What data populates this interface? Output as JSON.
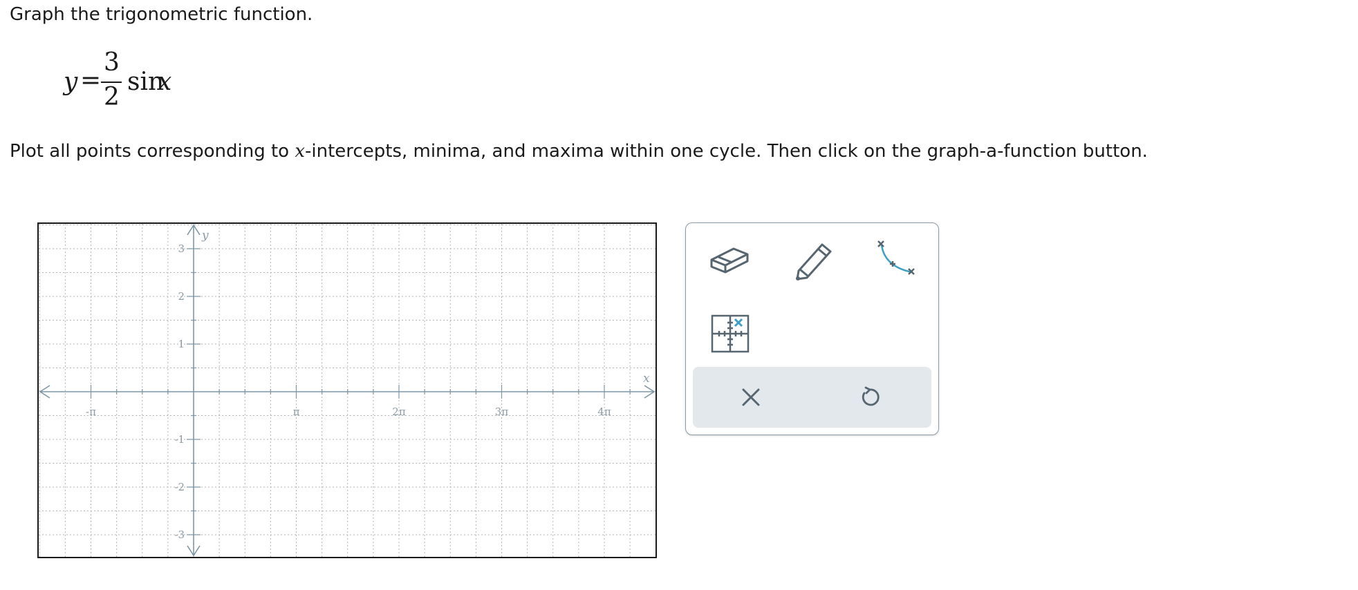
{
  "question": {
    "prompt": "Graph the trigonometric function.",
    "equation": {
      "lhs": "y",
      "equals": "=",
      "numerator": "3",
      "denominator": "2",
      "function": "sin",
      "variable": "x"
    },
    "instruction_before": "Plot all points corresponding to ",
    "instruction_var": "x",
    "instruction_after": "-intercepts, minima, and maxima within one cycle. Then click on the graph-a-function button."
  },
  "graph": {
    "x_axis_label": "x",
    "y_axis_label": "y",
    "x_ticks": [
      {
        "value": -1,
        "label": "-π"
      },
      {
        "value": 1,
        "label": "π"
      },
      {
        "value": 2,
        "label": "2π"
      },
      {
        "value": 3,
        "label": "3π"
      },
      {
        "value": 4,
        "label": "4π"
      }
    ],
    "y_ticks": [
      {
        "value": 3,
        "label": "3"
      },
      {
        "value": 2,
        "label": "2"
      },
      {
        "value": 1,
        "label": "1"
      },
      {
        "value": -1,
        "label": "-1"
      },
      {
        "value": -2,
        "label": "-2"
      },
      {
        "value": -3,
        "label": "-3"
      }
    ],
    "x_units": "multiples of π",
    "colors": {
      "axis": "#7d96a6",
      "grid": "#b3b3b3",
      "label": "#8a9ba5"
    }
  },
  "toolbar": {
    "tools": [
      {
        "name": "eraser-icon"
      },
      {
        "name": "pencil-icon"
      },
      {
        "name": "graph-function-icon"
      },
      {
        "name": "point-grid-icon"
      }
    ],
    "actions": [
      {
        "name": "close-icon"
      },
      {
        "name": "undo-icon"
      }
    ],
    "colors": {
      "icon": "#56656f",
      "accent": "#3d9fc1",
      "action_bg": "#e2e8eb"
    }
  }
}
